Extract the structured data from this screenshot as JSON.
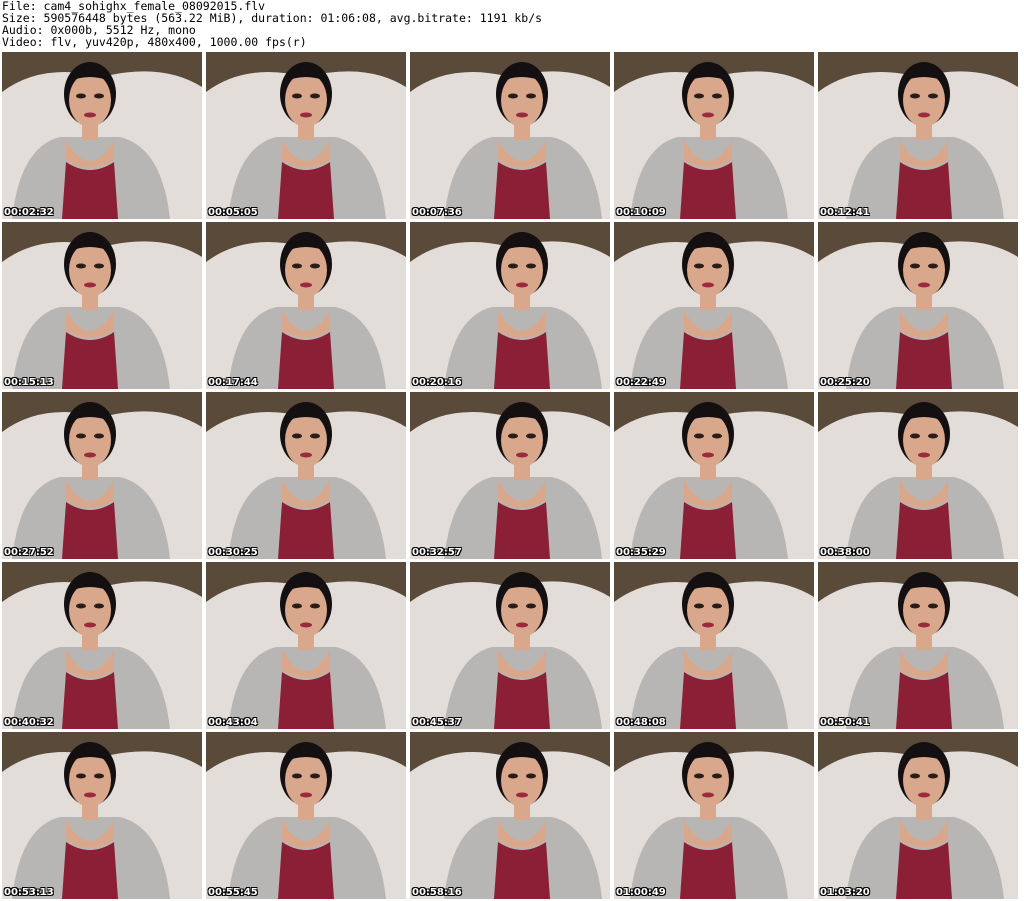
{
  "header": {
    "file": "File: cam4_sohighx_female_08092015.flv",
    "size": "Size: 590576448 bytes (563.22 MiB), duration: 01:06:08, avg.bitrate: 1191 kb/s",
    "audio": "Audio: 0x000b, 5512 Hz, mono",
    "video": "Video: flv, yuv420p, 480x400, 1000.00 fps(r)"
  },
  "thumbnails": [
    {
      "timestamp": "00:02:32"
    },
    {
      "timestamp": "00:05:05"
    },
    {
      "timestamp": "00:07:36"
    },
    {
      "timestamp": "00:10:09"
    },
    {
      "timestamp": "00:12:41"
    },
    {
      "timestamp": "00:15:13"
    },
    {
      "timestamp": "00:17:44"
    },
    {
      "timestamp": "00:20:16"
    },
    {
      "timestamp": "00:22:49"
    },
    {
      "timestamp": "00:25:20"
    },
    {
      "timestamp": "00:27:52"
    },
    {
      "timestamp": "00:30:25"
    },
    {
      "timestamp": "00:32:57"
    },
    {
      "timestamp": "00:35:29"
    },
    {
      "timestamp": "00:38:00"
    },
    {
      "timestamp": "00:40:32"
    },
    {
      "timestamp": "00:43:04"
    },
    {
      "timestamp": "00:45:37"
    },
    {
      "timestamp": "00:48:08"
    },
    {
      "timestamp": "00:50:41"
    },
    {
      "timestamp": "00:53:13"
    },
    {
      "timestamp": "00:55:45"
    },
    {
      "timestamp": "00:58:16"
    },
    {
      "timestamp": "01:00:49"
    },
    {
      "timestamp": "01:03:20"
    }
  ],
  "colors": {
    "wall": "#5a4a3a",
    "sofa": "#e2ddd8",
    "cardigan": "#b8b6b4",
    "top": "#8a1f35",
    "skin": "#d9a88c",
    "hair": "#141012"
  }
}
